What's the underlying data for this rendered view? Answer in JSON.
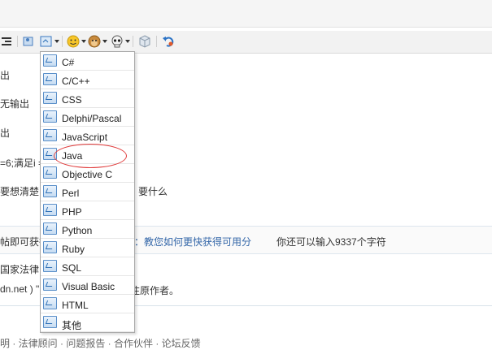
{
  "toolbar": {
    "icons": [
      "align-icon",
      "image-icon",
      "code-insert-icon",
      "emoticon-icon",
      "monkey-emoticon-icon",
      "skull-emoticon-icon",
      "cube-icon",
      "undo-icon"
    ]
  },
  "editor": {
    "line1": "出",
    "line2": "无输出",
    "line3": "出",
    "line4": "=6;满足i =",
    "line5": "要想清楚自",
    "line5b": "要什么"
  },
  "infobar": {
    "left": "帖即可获得",
    "link": "：教您如何更快获得可用分",
    "remaining": "你还可以输入9337个字符"
  },
  "notice": {
    "line1": "国家法律",
    "line2a": "dn.net ) \"",
    "line2b": "注原作者。"
  },
  "bottom": {
    "links": "明 · 法律顾问 · 问题报告 · 合作伙伴 · 论坛反馈"
  },
  "code_menu": {
    "items": [
      "C#",
      "C/C++",
      "CSS",
      "Delphi/Pascal",
      "JavaScript",
      "Java",
      "Objective C",
      "Perl",
      "PHP",
      "Python",
      "Ruby",
      "SQL",
      "Visual Basic",
      "HTML",
      "其他"
    ],
    "highlighted": "Java"
  }
}
